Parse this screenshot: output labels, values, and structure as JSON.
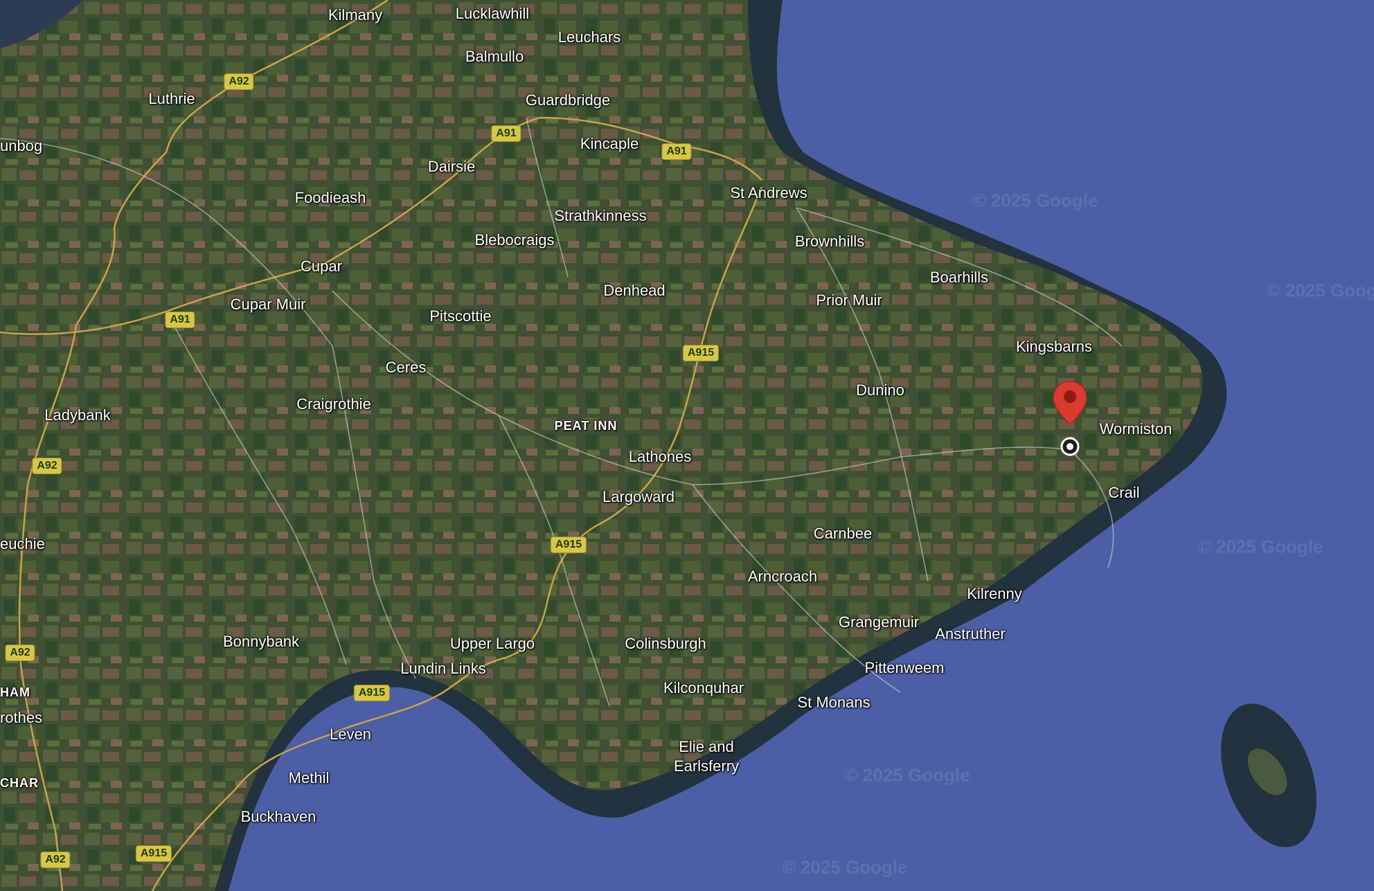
{
  "map": {
    "type": "satellite",
    "colors": {
      "sea": "#4c5fa6",
      "land": "#3f5034",
      "road": "#c9a24a",
      "pin": "#d93b2f"
    },
    "places": [
      {
        "id": "kilmany",
        "label": "Kilmany"
      },
      {
        "id": "lucklawhill",
        "label": "Lucklawhill"
      },
      {
        "id": "leuchars",
        "label": "Leuchars"
      },
      {
        "id": "balmullo",
        "label": "Balmullo"
      },
      {
        "id": "luthrie",
        "label": "Luthrie"
      },
      {
        "id": "guardbridge",
        "label": "Guardbridge"
      },
      {
        "id": "dunbog",
        "label": "unbog"
      },
      {
        "id": "kincaple",
        "label": "Kincaple"
      },
      {
        "id": "dairsie",
        "label": "Dairsie"
      },
      {
        "id": "foodieash",
        "label": "Foodieash"
      },
      {
        "id": "st-andrews",
        "label": "St Andrews"
      },
      {
        "id": "strathkinness",
        "label": "Strathkinness"
      },
      {
        "id": "blebocraigs",
        "label": "Blebocraigs"
      },
      {
        "id": "brownhills",
        "label": "Brownhills"
      },
      {
        "id": "cupar",
        "label": "Cupar"
      },
      {
        "id": "boarhills",
        "label": "Boarhills"
      },
      {
        "id": "cupar-muir",
        "label": "Cupar Muir"
      },
      {
        "id": "denhead",
        "label": "Denhead"
      },
      {
        "id": "prior-muir",
        "label": "Prior Muir"
      },
      {
        "id": "pitscottie",
        "label": "Pitscottie"
      },
      {
        "id": "kingsbarns",
        "label": "Kingsbarns"
      },
      {
        "id": "ceres",
        "label": "Ceres"
      },
      {
        "id": "dunino",
        "label": "Dunino"
      },
      {
        "id": "craigrothie",
        "label": "Craigrothie"
      },
      {
        "id": "ladybank",
        "label": "Ladybank"
      },
      {
        "id": "peat-inn",
        "label": "PEAT INN"
      },
      {
        "id": "wormiston",
        "label": "Wormiston"
      },
      {
        "id": "lathones",
        "label": "Lathones"
      },
      {
        "id": "crail",
        "label": "Crail"
      },
      {
        "id": "largoward",
        "label": "Largoward"
      },
      {
        "id": "carnbee",
        "label": "Carnbee"
      },
      {
        "id": "freuchie",
        "label": "euchie"
      },
      {
        "id": "arncroach",
        "label": "Arncroach"
      },
      {
        "id": "kilrenny",
        "label": "Kilrenny"
      },
      {
        "id": "grangemuir",
        "label": "Grangemuir"
      },
      {
        "id": "anstruther",
        "label": "Anstruther"
      },
      {
        "id": "bonnybank",
        "label": "Bonnybank"
      },
      {
        "id": "upper-largo",
        "label": "Upper Largo"
      },
      {
        "id": "colinsburgh",
        "label": "Colinsburgh"
      },
      {
        "id": "lundin-links",
        "label": "Lundin Links"
      },
      {
        "id": "pittenweem",
        "label": "Pittenweem"
      },
      {
        "id": "markinch",
        "label": "HAM"
      },
      {
        "id": "kilconquhar",
        "label": "Kilconquhar"
      },
      {
        "id": "st-monans",
        "label": "St Monans"
      },
      {
        "id": "glenrothes",
        "label": "rothes"
      },
      {
        "id": "leven",
        "label": "Leven"
      },
      {
        "id": "elie-1",
        "label": "Elie and"
      },
      {
        "id": "elie-2",
        "label": "Earlsferry"
      },
      {
        "id": "methil",
        "label": "Methil"
      },
      {
        "id": "cadham",
        "label": "CHAR"
      },
      {
        "id": "buckhaven",
        "label": "Buckhaven"
      }
    ],
    "road_shields": [
      {
        "id": "a92-1",
        "label": "A92"
      },
      {
        "id": "a91-1",
        "label": "A91"
      },
      {
        "id": "a91-2",
        "label": "A91"
      },
      {
        "id": "a91-3",
        "label": "A91"
      },
      {
        "id": "a915-1",
        "label": "A915"
      },
      {
        "id": "a92-2",
        "label": "A92"
      },
      {
        "id": "a915-2",
        "label": "A915"
      },
      {
        "id": "a92-3",
        "label": "A92"
      },
      {
        "id": "a915-3",
        "label": "A915"
      },
      {
        "id": "a92-4",
        "label": "A92"
      },
      {
        "id": "a915-4",
        "label": "A915"
      }
    ],
    "watermarks": [
      "© 2025 Google",
      "© 2025 Google",
      "© 2025 Google",
      "© 2025 Google",
      "© 2025 Google"
    ],
    "marker": {
      "icon": "location-pin-icon",
      "target_icon": "target-circle-icon"
    }
  }
}
